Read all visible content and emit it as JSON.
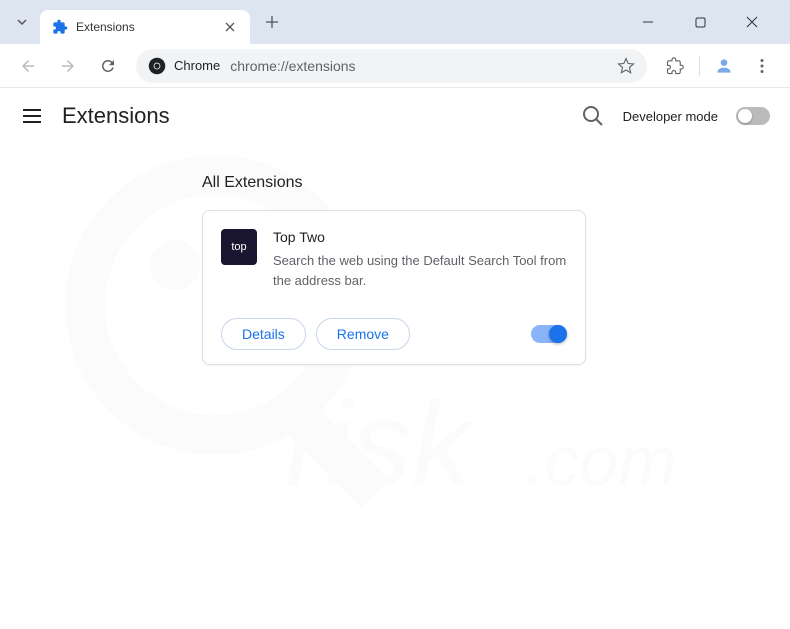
{
  "titlebar": {
    "tab_title": "Extensions",
    "tab_icon_text": "puzzle"
  },
  "toolbar": {
    "chrome_label": "Chrome",
    "url": "chrome://extensions"
  },
  "header": {
    "title": "Extensions",
    "dev_mode_label": "Developer mode"
  },
  "section": {
    "title": "All Extensions"
  },
  "extension": {
    "icon_text": "top",
    "name": "Top Two",
    "description": "Search the web using the Default Search Tool from the address bar.",
    "details_label": "Details",
    "remove_label": "Remove"
  },
  "colors": {
    "accent": "#1a73e8",
    "tab_bg": "#dde5f0"
  }
}
